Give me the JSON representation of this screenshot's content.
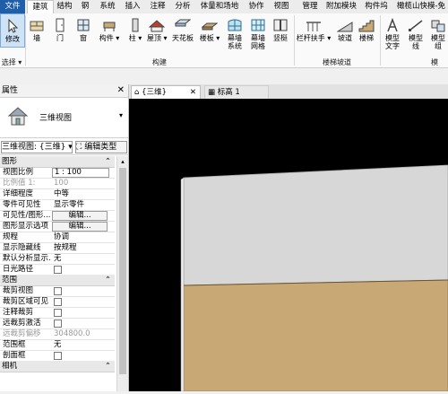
{
  "tabs": [
    "文件",
    "建筑",
    "结构",
    "钢",
    "系统",
    "插入",
    "注释",
    "分析",
    "体量和场地",
    "协作",
    "视图",
    "管理",
    "附加模块",
    "构件坞",
    "橄榄山快模-免"
  ],
  "ribbon": {
    "modify": "修改",
    "select": "选择",
    "build": [
      "墙",
      "门",
      "窗",
      "构件",
      "柱",
      "屋顶",
      "天花板",
      "楼板",
      "幕墙\n系统",
      "幕墙\n网格",
      "竖梃"
    ],
    "build_panel": "构建",
    "stairs": [
      "栏杆扶手",
      "坡道",
      "楼梯"
    ],
    "stairs_panel": "楼梯坡道",
    "model": [
      "模型\n文字",
      "模型\n线",
      "模型\n组"
    ],
    "model_panel": "模"
  },
  "properties": {
    "title": "属性",
    "type_name": "三维视图",
    "selector": "三维视图: {三维}",
    "edit_type": "编辑类型",
    "categories": {
      "graphics": "图形",
      "extents": "范围",
      "camera": "相机"
    },
    "rows": [
      {
        "k": "视图比例",
        "v": "1 : 100"
      },
      {
        "k": "比例值 1:",
        "v": "100"
      },
      {
        "k": "详细程度",
        "v": "中等"
      },
      {
        "k": "零件可见性",
        "v": "显示零件"
      },
      {
        "k": "可见性/图形...",
        "v": "编辑..."
      },
      {
        "k": "图形显示选项",
        "v": "编辑..."
      },
      {
        "k": "规程",
        "v": "协调"
      },
      {
        "k": "显示隐藏线",
        "v": "按规程"
      },
      {
        "k": "默认分析显示...",
        "v": "无"
      },
      {
        "k": "日光路径",
        "v": ""
      },
      {
        "k": "裁剪视图",
        "v": ""
      },
      {
        "k": "裁剪区域可见",
        "v": ""
      },
      {
        "k": "注释裁剪",
        "v": ""
      },
      {
        "k": "远裁剪激活",
        "v": ""
      },
      {
        "k": "远裁剪偏移",
        "v": "304800.0"
      },
      {
        "k": "范围框",
        "v": "无"
      },
      {
        "k": "剖面框",
        "v": ""
      }
    ]
  },
  "views": {
    "tab1": "{三维}",
    "tab2": "标高 1"
  },
  "colors": {
    "file_tab": "#1f5ea8",
    "wall_upper": "#d7d7d7",
    "wall_lower": "#c8a875",
    "canvas": "#000000"
  }
}
